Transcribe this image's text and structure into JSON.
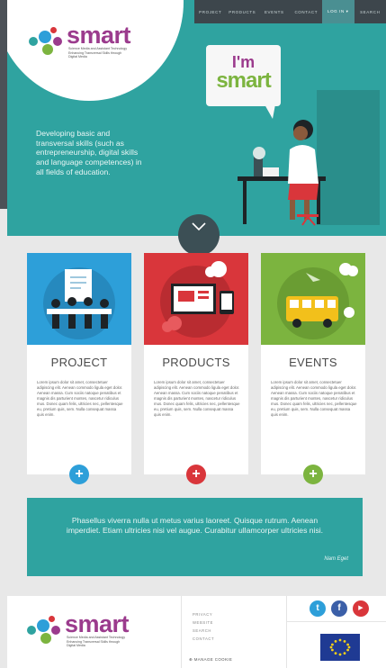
{
  "nav": {
    "items": [
      "Project",
      "Products",
      "Events",
      "Contact"
    ],
    "login": "Log in ▾",
    "search": "Search"
  },
  "logo": {
    "word": "smart",
    "subtitle_1": "Science Media and Assistant Technology",
    "subtitle_2": "Enhancing Transversal Skills through",
    "subtitle_3": "Digital Media"
  },
  "hero": {
    "text": "Developing basic and transversal skills (such as entrepreneurship, digital skills and language competences) in all fields of education.",
    "bubble_line1": "I'm",
    "bubble_line2": "smart"
  },
  "cards": [
    {
      "title": "PROJECT",
      "body": "Lorem ipsum dolor sit amet, consectetuer adipiscing elit. Aenean commodo ligula eget dolor. Aenean massa. Cum sociis natoque penatibus et magnis dis parturient montes, nascetur ridiculus mus. Donec quam felis, ultricies nec, pellentesque eu, pretium quis, sem. Nulla consequat massa quis enim.",
      "color": "#2d9fd9"
    },
    {
      "title": "PRODUCTS",
      "body": "Lorem ipsum dolor sit amet, consectetuer adipiscing elit. Aenean commodo ligula eget dolor. Aenean massa. Cum sociis natoque penatibus et magnis dis parturient montes, nascetur ridiculus mus. Donec quam felis, ultricies nec, pellentesque eu, pretium quis, sem. Nulla consequat massa quis enim.",
      "color": "#d9363b"
    },
    {
      "title": "EVENTS",
      "body": "Lorem ipsum dolor sit amet, consectetuer adipiscing elit. Aenean commodo ligula eget dolor. Aenean massa. Cum sociis natoque penatibus et magnis dis parturient montes, nascetur ridiculus mus. Donec quam felis, ultricies nec, pellentesque eu, pretium quis, sem. Nulla consequat massa quis enim.",
      "color": "#7cb43f"
    }
  ],
  "plus_symbol": "+",
  "quote": {
    "text": "Phasellus viverra nulla ut metus varius laoreet. Quisque rutrum. Aenean imperdiet. Etiam ultricies nisi vel augue. Curabitur ullamcorper ultricies nisi.",
    "author": "Nam Eget"
  },
  "footer": {
    "links": [
      "Privacy",
      "Website",
      "Search",
      "Contact"
    ],
    "cookie": "⊕ Manage cookie",
    "social": [
      "t",
      "f",
      "▶"
    ]
  },
  "colors": {
    "teal": "#2fa3a0",
    "nav_dark": "#3d464c",
    "blue": "#2d9fd9",
    "red": "#d9363b",
    "green": "#7cb43f",
    "purple": "#9b3b8d"
  }
}
